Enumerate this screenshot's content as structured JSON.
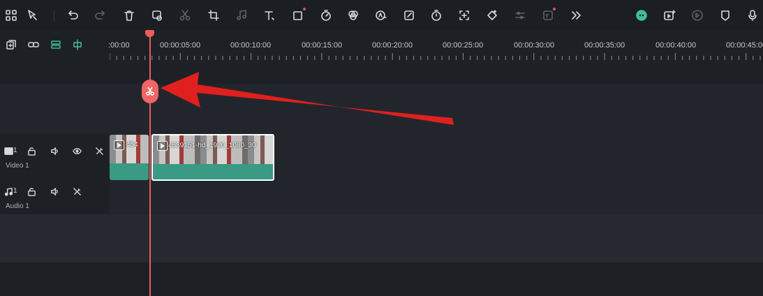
{
  "toolbar": {
    "icons": [
      "grid-icon",
      "select-arrow-icon",
      "undo-icon",
      "redo-icon",
      "delete-icon",
      "ripple-delete-icon",
      "cut-icon",
      "crop-icon",
      "audio-icon",
      "text-icon",
      "shape-icon",
      "speed-icon",
      "color-icon",
      "ai-icon",
      "edit-icon",
      "timer-icon",
      "auto-reframe-icon",
      "keyframe-icon",
      "adjust-icon",
      "ai-text-icon",
      "more-icon",
      "avatar-icon",
      "render-icon",
      "preview-icon",
      "mark-icon",
      "mic-icon"
    ]
  },
  "ruler": {
    "labels": [
      ":00:00",
      "00:00:05:00",
      "00:00:10:00",
      "00:00:15:00",
      "00:00:20:00",
      "00:00:25:00",
      "00:00:30:00",
      "00:00:35:00",
      "00:00:40:00",
      "00:00:45:00"
    ]
  },
  "tracks": {
    "video": {
      "index": "1",
      "name": "Video 1"
    },
    "audio": {
      "index": "1",
      "name": "Audio 1"
    }
  },
  "clips": [
    {
      "title": "454"
    },
    {
      "title": "4539151-hd_1920_1080_30"
    }
  ],
  "colors": {
    "playhead": "#f05b5b",
    "clip": "#3a9a83",
    "accent": "#3fbf95",
    "arrow": "#e0201f"
  }
}
